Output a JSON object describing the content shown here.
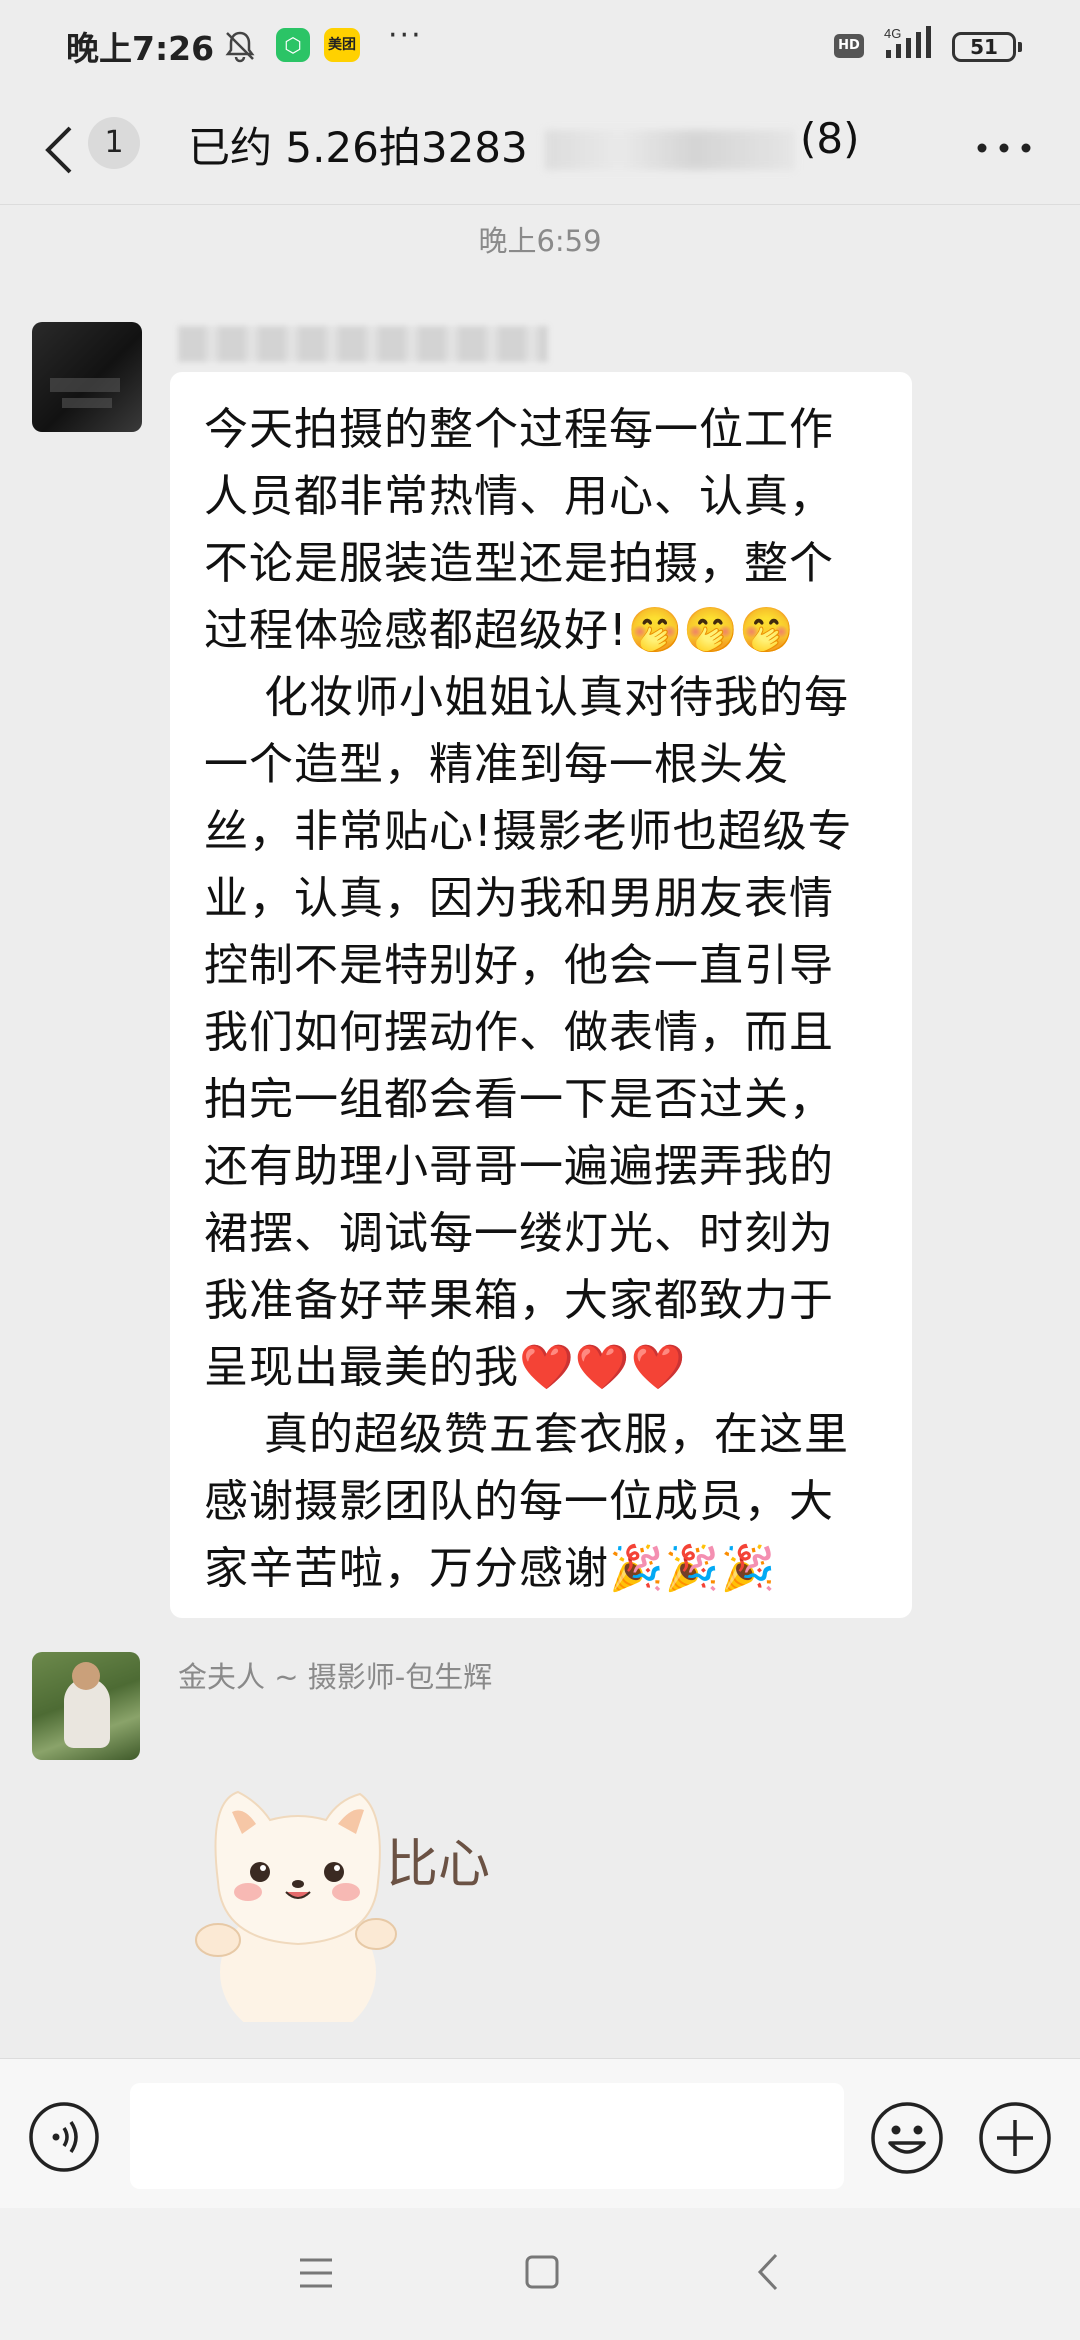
{
  "status_bar": {
    "time": "晚上7:26",
    "app_badge_1": "⬡",
    "app_badge_2": "美团",
    "more": "···",
    "hd": "HD",
    "network": "4G",
    "battery": "51"
  },
  "header": {
    "unread_count": "1",
    "title": "已约 5.26拍3283",
    "member_count": "(8)"
  },
  "chat": {
    "timestamp": "晚上6:59",
    "messages": [
      {
        "sender": "",
        "text": "今天拍摄的整个过程每一位工作人员都非常热情、用心、认真，不论是服装造型还是拍摄，整个过程体验感都超级好!🤭🤭🤭\n    化妆师小姐姐认真对待我的每一个造型，精准到每一根头发丝，非常贴心!摄影老师也超级专业，认真，因为我和男朋友表情控制不是特别好，他会一直引导我们如何摆动作、做表情，而且拍完一组都会看一下是否过关，还有助理小哥哥一遍遍摆弄我的裙摆、调试每一缕灯光、时刻为我准备好苹果箱，大家都致力于呈现出最美的我❤️❤️❤️\n    真的超级赞五套衣服，在这里感谢摄影团队的每一位成员，大家辛苦啦，万分感谢🎉🎉🎉"
      },
      {
        "sender": "金夫人 ~ 摄影师-包生辉",
        "sticker_text": "比心"
      }
    ]
  },
  "input_bar": {
    "placeholder": ""
  }
}
